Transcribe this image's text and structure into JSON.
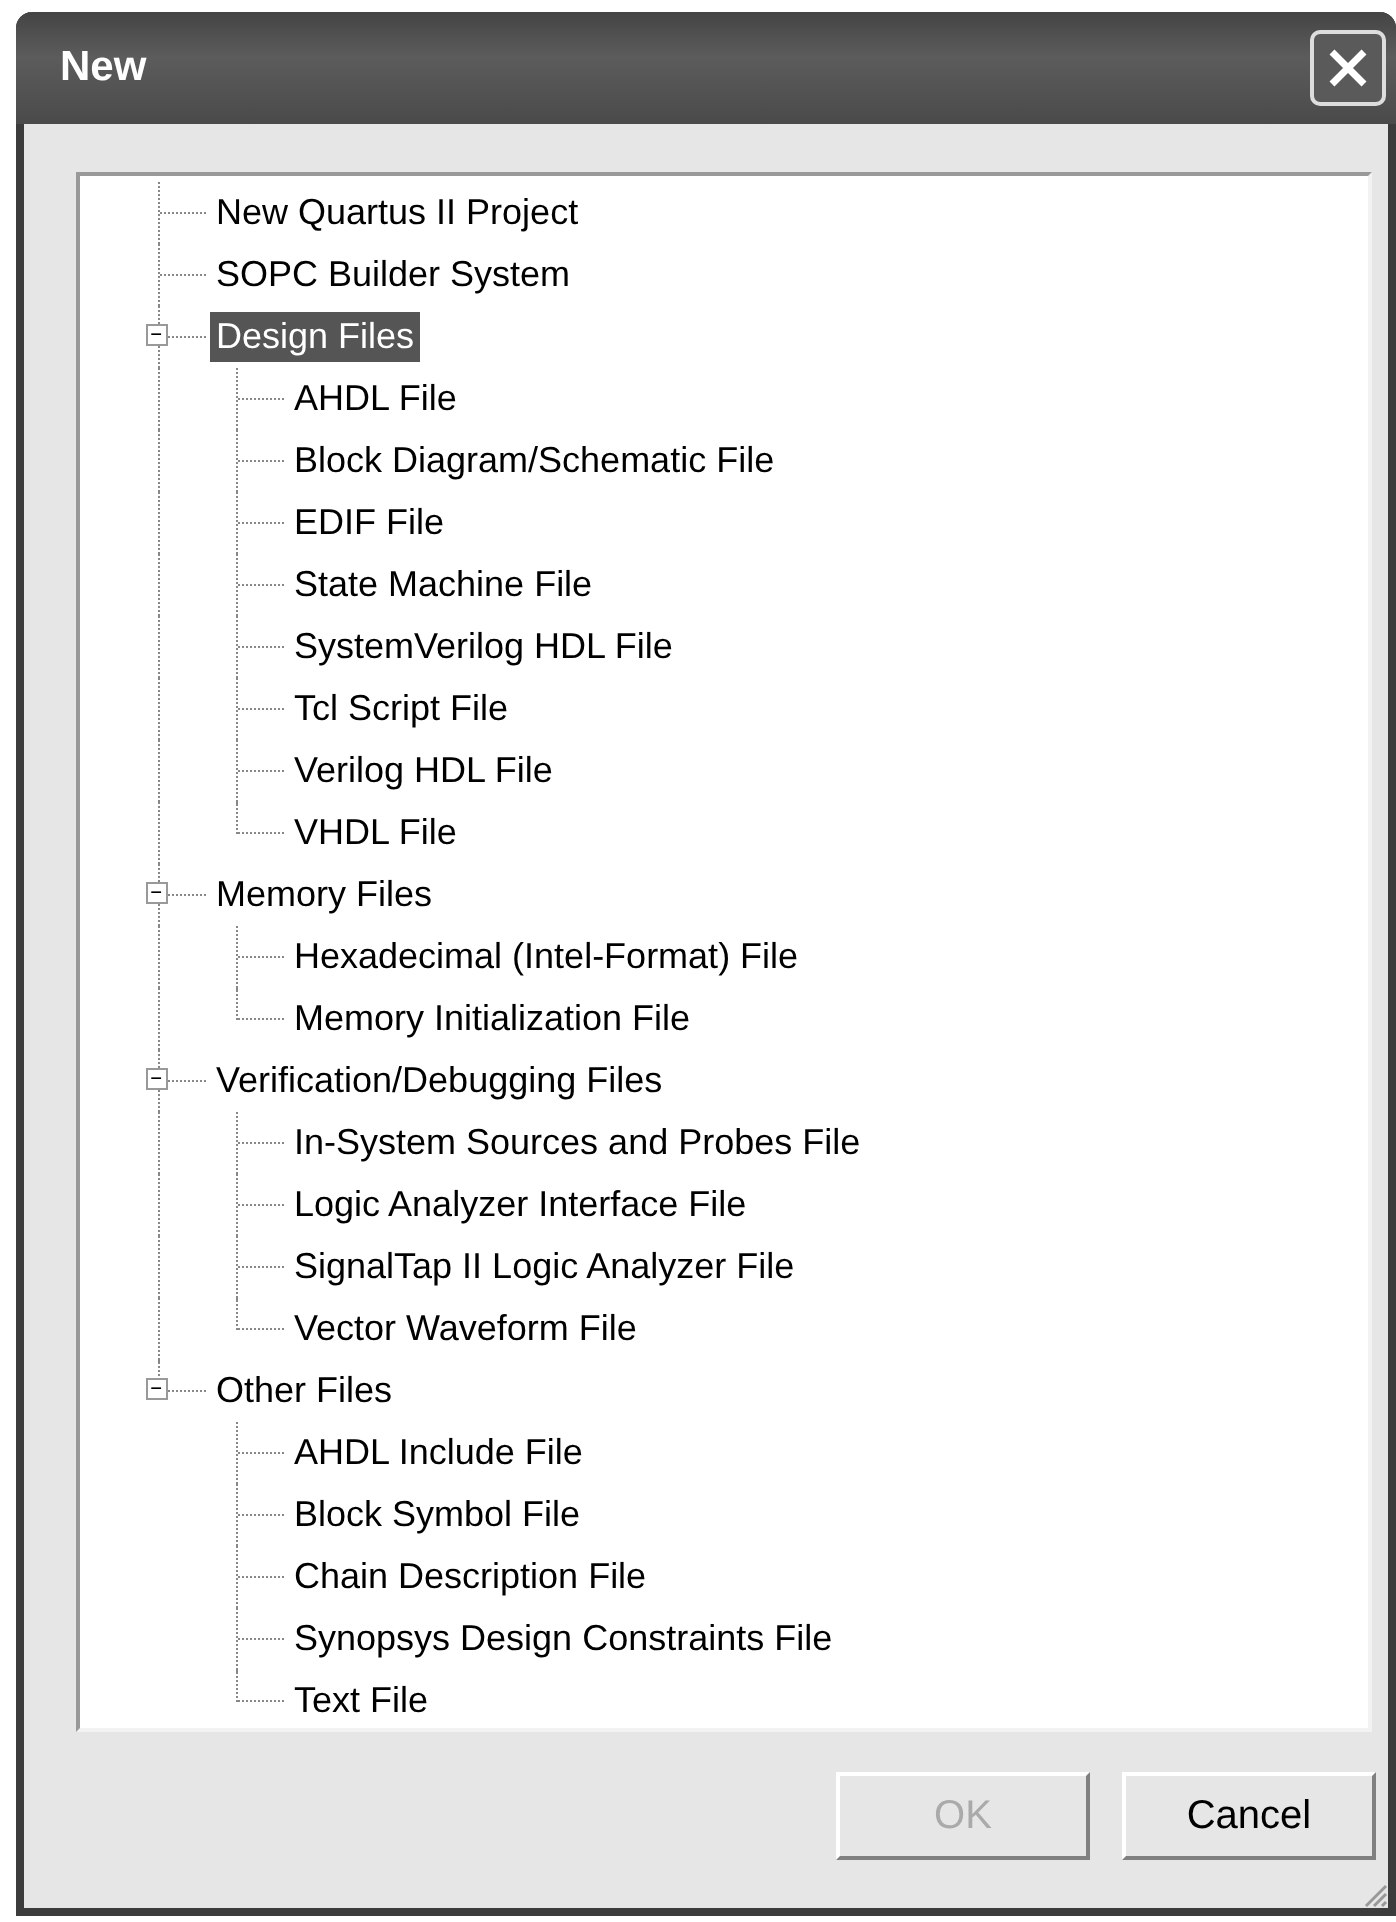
{
  "window": {
    "title": "New"
  },
  "tree": [
    {
      "label": "New Quartus II Project",
      "selected": false
    },
    {
      "label": "SOPC Builder System",
      "selected": false
    },
    {
      "label": "Design Files",
      "selected": true,
      "expanded": true,
      "children": [
        {
          "label": "AHDL File",
          "selected": false
        },
        {
          "label": "Block Diagram/Schematic File",
          "selected": false
        },
        {
          "label": "EDIF File",
          "selected": false
        },
        {
          "label": "State Machine File",
          "selected": false
        },
        {
          "label": "SystemVerilog HDL File",
          "selected": false
        },
        {
          "label": "Tcl Script File",
          "selected": false
        },
        {
          "label": "Verilog HDL File",
          "selected": false
        },
        {
          "label": "VHDL File",
          "selected": false
        }
      ]
    },
    {
      "label": "Memory Files",
      "selected": false,
      "expanded": true,
      "children": [
        {
          "label": "Hexadecimal (Intel-Format) File",
          "selected": false
        },
        {
          "label": "Memory Initialization File",
          "selected": false
        }
      ]
    },
    {
      "label": "Verification/Debugging Files",
      "selected": false,
      "expanded": true,
      "children": [
        {
          "label": "In-System Sources and Probes File",
          "selected": false
        },
        {
          "label": "Logic Analyzer Interface File",
          "selected": false
        },
        {
          "label": "SignalTap II Logic Analyzer File",
          "selected": false
        },
        {
          "label": "Vector Waveform File",
          "selected": false
        }
      ]
    },
    {
      "label": "Other Files",
      "selected": false,
      "expanded": true,
      "children": [
        {
          "label": "AHDL Include File",
          "selected": false
        },
        {
          "label": "Block Symbol File",
          "selected": false
        },
        {
          "label": "Chain Description File",
          "selected": false
        },
        {
          "label": "Synopsys Design Constraints File",
          "selected": false
        },
        {
          "label": "Text File",
          "selected": false
        }
      ]
    }
  ],
  "buttons": [
    {
      "label": "OK",
      "disabled": true
    },
    {
      "label": "Cancel",
      "disabled": false
    }
  ]
}
